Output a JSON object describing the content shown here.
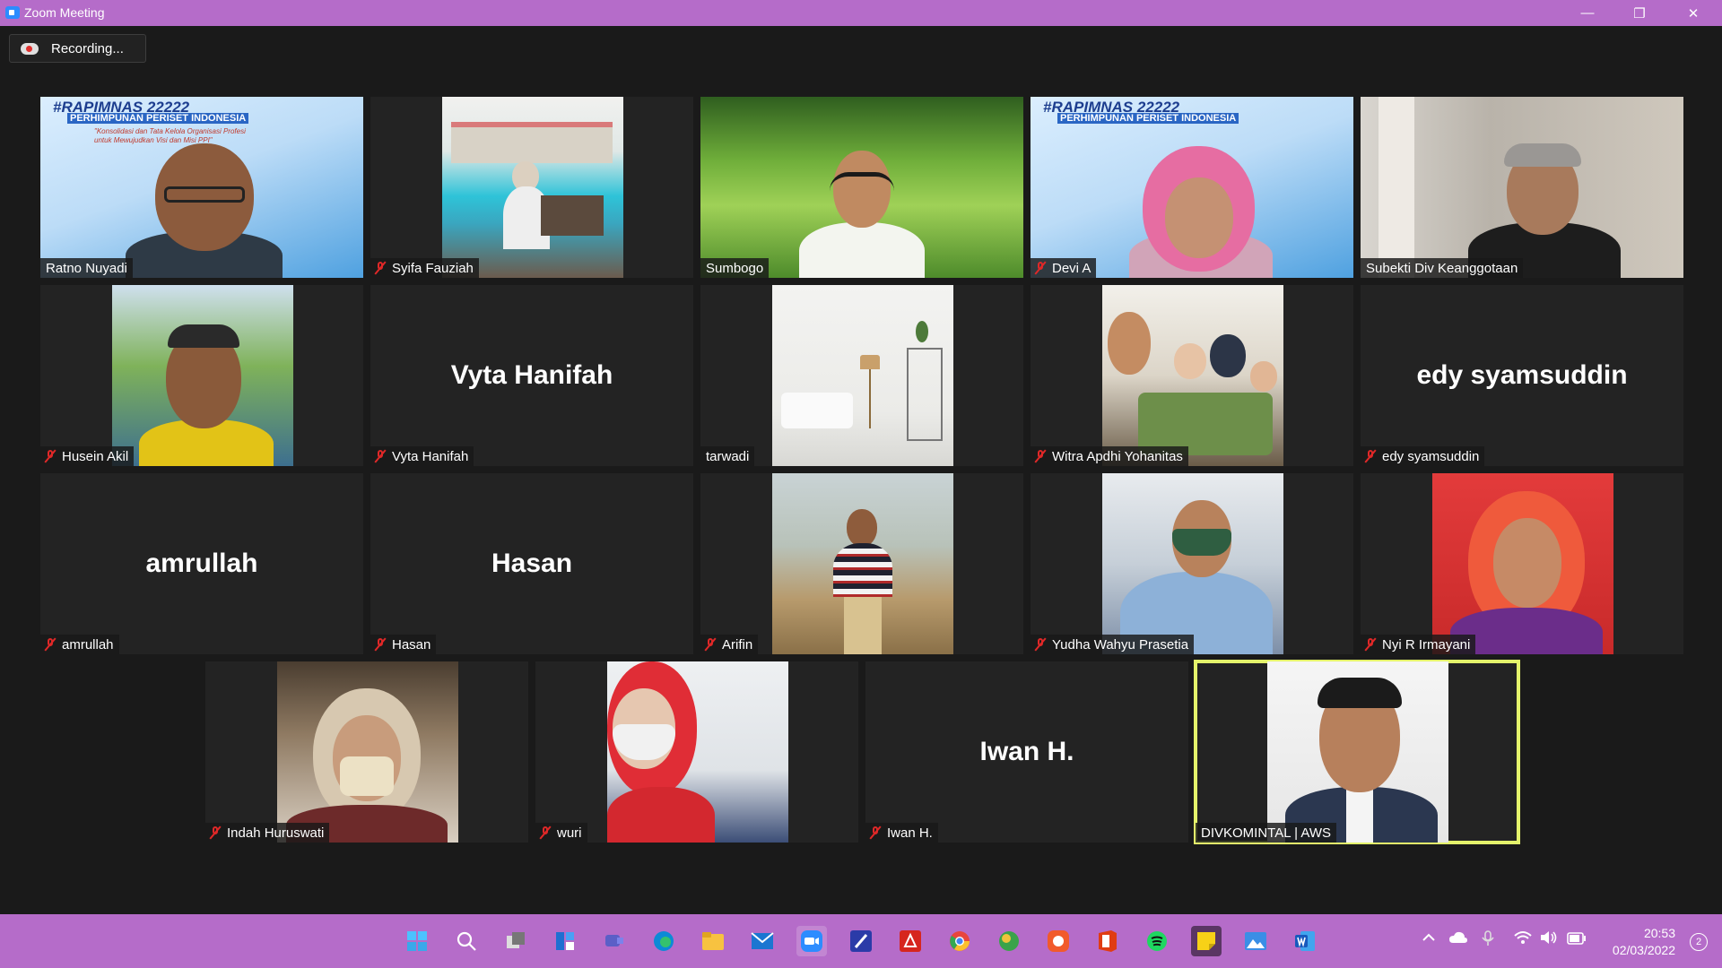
{
  "window": {
    "title": "Zoom Meeting",
    "minimize": "—",
    "restore": "❐",
    "close": "✕"
  },
  "recording": {
    "label": "Recording..."
  },
  "participants": [
    {
      "name": "Ratno Nuyadi",
      "muted": false,
      "video": true,
      "active": false
    },
    {
      "name": "Syifa Fauziah",
      "muted": true,
      "video": true,
      "active": false
    },
    {
      "name": "Sumbogo",
      "muted": false,
      "video": true,
      "active": false
    },
    {
      "name": "Devi A",
      "muted": true,
      "video": true,
      "active": false
    },
    {
      "name": "Subekti Div Keanggotaan",
      "muted": false,
      "video": true,
      "active": false
    },
    {
      "name": "Husein Akil",
      "muted": true,
      "video": true,
      "active": false
    },
    {
      "name": "Vyta Hanifah",
      "muted": true,
      "video": false,
      "active": false
    },
    {
      "name": "tarwadi",
      "muted": false,
      "video": true,
      "active": false
    },
    {
      "name": "Witra Apdhi Yohanitas",
      "muted": true,
      "video": true,
      "active": false
    },
    {
      "name": "edy syamsuddin",
      "muted": true,
      "video": false,
      "active": false
    },
    {
      "name": "amrullah",
      "muted": true,
      "video": false,
      "active": false
    },
    {
      "name": "Hasan",
      "muted": true,
      "video": false,
      "active": false
    },
    {
      "name": "Arifin",
      "muted": true,
      "video": true,
      "active": false
    },
    {
      "name": "Yudha Wahyu Prasetia",
      "muted": true,
      "video": true,
      "active": false
    },
    {
      "name": "Nyi R Irmayani",
      "muted": true,
      "video": true,
      "active": false
    },
    {
      "name": "Indah Huruswati",
      "muted": true,
      "video": true,
      "active": false
    },
    {
      "name": "wuri",
      "muted": true,
      "video": true,
      "active": false
    },
    {
      "name": "Iwan H.",
      "muted": true,
      "video": false,
      "active": false
    },
    {
      "name": "DIVKOMINTAL | AWS",
      "muted": false,
      "video": true,
      "active": true
    }
  ],
  "banner": {
    "line1": "#RAPIMNAS 22222",
    "line2": "PERHIMPUNAN PERISET INDONESIA",
    "line3": "\"Konsolidasi dan Tata Kelola Organisasi Profesi",
    "line4": "untuk Mewujudkan Visi dan Misi PPI\""
  },
  "taskbar": {
    "icons": [
      "windows-start-icon",
      "search-icon",
      "task-view-icon",
      "widgets-icon",
      "teams-chat-icon",
      "edge-icon",
      "file-explorer-icon",
      "mail-icon",
      "zoom-icon",
      "app-icon",
      "acrobat-icon",
      "chrome-icon",
      "maps-app-icon",
      "photo-app-icon",
      "office-icon",
      "spotify-icon",
      "sticky-notes-icon",
      "photos-icon",
      "word-icon"
    ],
    "time": "20:53",
    "date": "02/03/2022",
    "notifications": "2"
  },
  "colors": {
    "accent": "#b56cc9",
    "active_speaker": "#e4f36b",
    "muted": "#e02828"
  }
}
